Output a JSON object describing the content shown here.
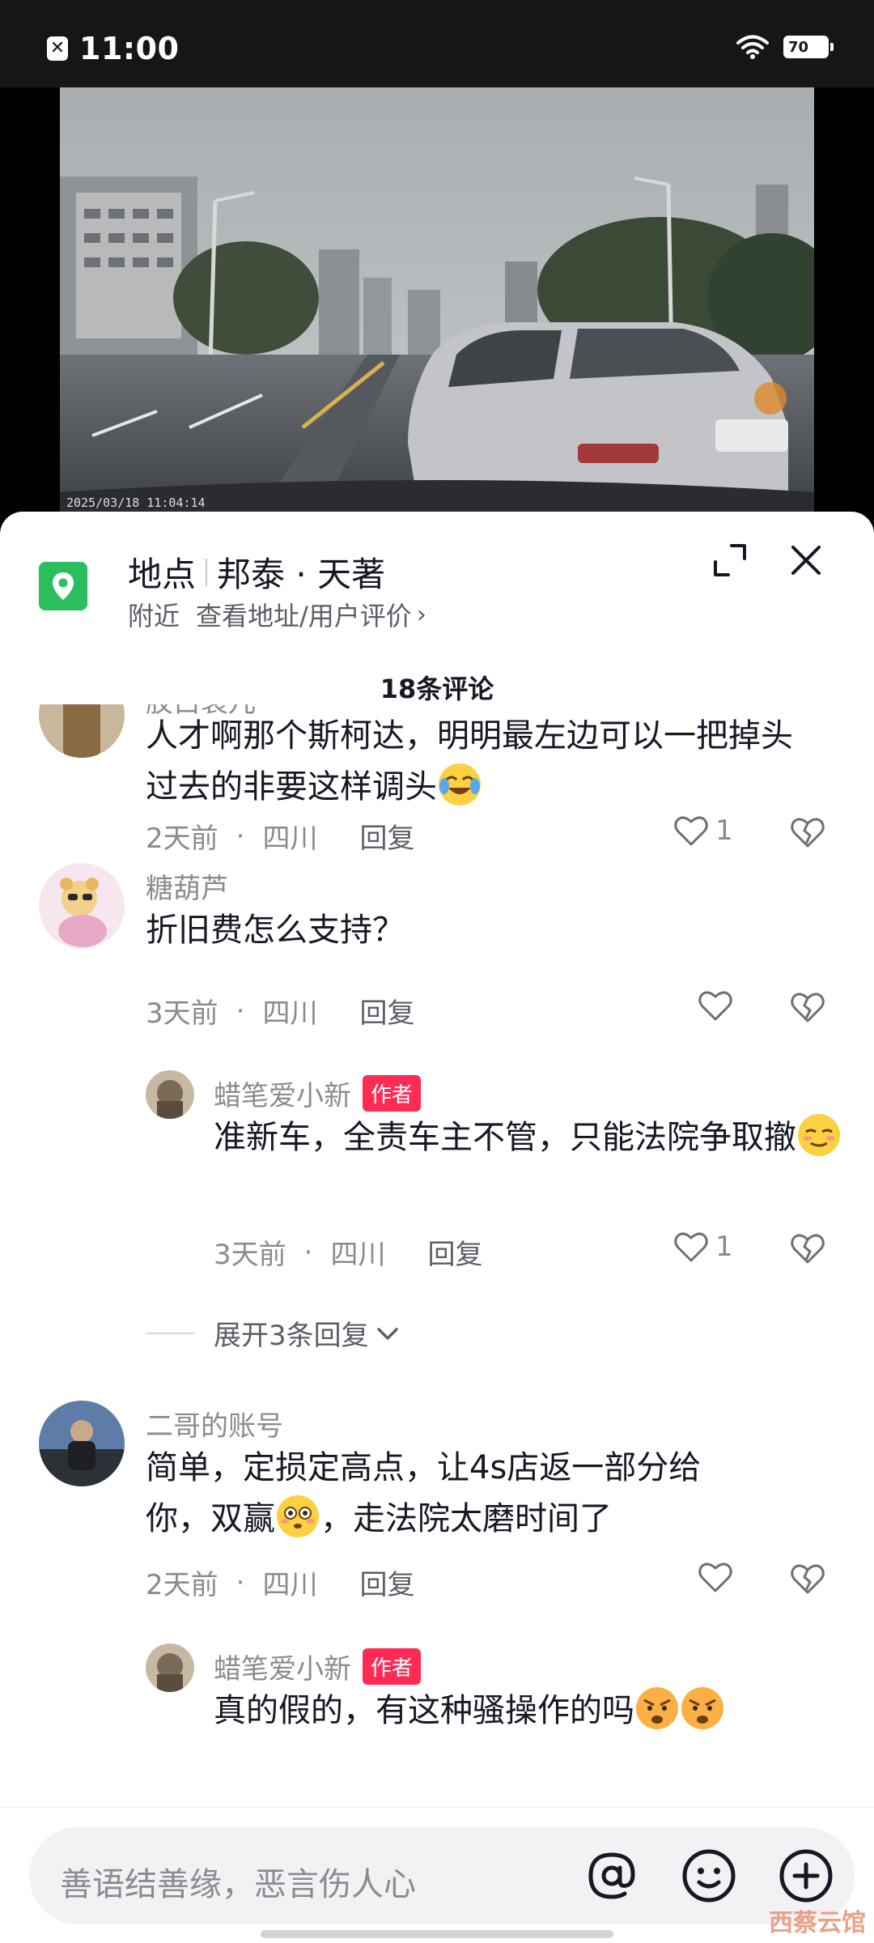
{
  "status_bar": {
    "time": "11:00",
    "battery": "70"
  },
  "video": {
    "timestamp": "2025/03/18  11:04:14"
  },
  "location": {
    "label": "地点",
    "name": "邦泰 · 天著",
    "nearby": "附近",
    "link": "查看地址/用户评价"
  },
  "comments_header": {
    "count_label": "18条评论"
  },
  "comments": [
    {
      "username": "胶白裘儿",
      "text": "人才啊那个斯柯达，明明最左边可以一把掉头过去的非要这样调头",
      "emoji": "crying-laughing-emoji",
      "time": "2天前",
      "region": "四川",
      "reply_label": "回复",
      "likes": "1"
    },
    {
      "username": "糖葫芦",
      "text": "折旧费怎么支持？",
      "time": "3天前",
      "region": "四川",
      "reply_label": "回复",
      "likes": ""
    },
    {
      "username": "蜡笔爱小新",
      "tag": "作者",
      "text": "准新车，全责车主不管，只能法院争取撤",
      "emoji": "relieved-emoji",
      "time": "3天前",
      "region": "四川",
      "reply_label": "回复",
      "likes": "1"
    },
    {
      "username": "二哥的账号",
      "text_line1": "简单，定损定高点，让4s店返一部分给",
      "text_line2_a": "你，双赢",
      "text_line2_b": "，走法院太磨时间了",
      "emoji": "flushed-emoji",
      "time": "2天前",
      "region": "四川",
      "reply_label": "回复",
      "likes": ""
    },
    {
      "username": "蜡笔爱小新",
      "tag": "作者",
      "text": "真的假的，有这种骚操作的吗",
      "emoji": "angry-emoji"
    }
  ],
  "expand_replies": {
    "label": "展开3条回复"
  },
  "input": {
    "placeholder": "善语结善缘，恶言伤人心"
  },
  "watermark": "西蔡云馆",
  "colors": {
    "accent": "#fe2c55",
    "location_green": "#2bbe5e"
  }
}
